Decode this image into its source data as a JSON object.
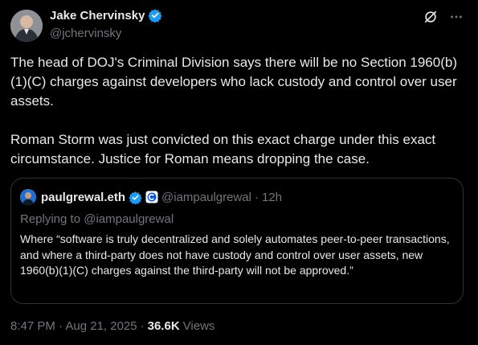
{
  "author": {
    "name": "Jake Chervinsky",
    "handle": "@jchervinsky"
  },
  "tweet": {
    "paragraphs": [
      "The head of DOJ's Criminal Division says there will be no Section 1960(b)(1)(C) charges against developers who lack custody and control over user assets.",
      "Roman Storm was just convicted on this exact charge under this exact circumstance. Justice for Roman means dropping the case."
    ]
  },
  "quote": {
    "name": "paulgrewal.eth",
    "handle": "@iampaulgrewal",
    "separator": "·",
    "time": "12h",
    "replying_to": "Replying to @iampaulgrewal",
    "text": "Where “software is truly decentralized and solely automates peer-to-peer transactions, and where a third-party does not have custody and control over user assets, new 1960(b)(1)(C) charges against the third-party will not be approved.”"
  },
  "meta": {
    "timestamp": "8:47 PM · Aug 21, 2025",
    "separator": "·",
    "views_count": "36.6K",
    "views_label": "Views"
  },
  "icons": {
    "verified": "verified-badge-icon",
    "grok": "grok-icon",
    "more": "more-icon",
    "affiliate": "coinbase-affiliate-icon"
  },
  "colors": {
    "background": "#000000",
    "text": "#e7e9ea",
    "muted": "#71767b",
    "verified": "#1d9bf0",
    "border": "#2f3336"
  }
}
